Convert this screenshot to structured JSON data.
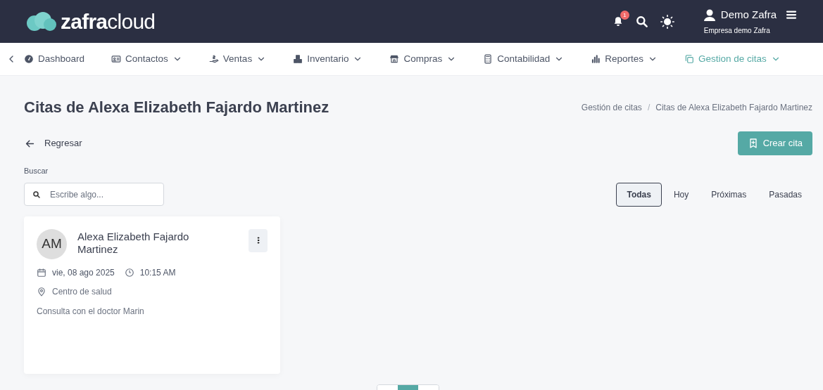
{
  "header": {
    "logo": {
      "bold": "zafra",
      "light": "cloud"
    },
    "notifications": "1",
    "user": {
      "name": "Demo Zafra",
      "company": "Empresa demo Zafra"
    }
  },
  "nav": [
    {
      "label": "Dashboard",
      "dropdown": false,
      "selected": false
    },
    {
      "label": "Contactos",
      "dropdown": true,
      "selected": false
    },
    {
      "label": "Ventas",
      "dropdown": true,
      "selected": false
    },
    {
      "label": "Inventario",
      "dropdown": true,
      "selected": false
    },
    {
      "label": "Compras",
      "dropdown": true,
      "selected": false
    },
    {
      "label": "Contabilidad",
      "dropdown": true,
      "selected": false
    },
    {
      "label": "Reportes",
      "dropdown": true,
      "selected": false
    },
    {
      "label": "Gestion de citas",
      "dropdown": true,
      "selected": true
    }
  ],
  "page": {
    "title": "Citas de Alexa Elizabeth Fajardo Martinez",
    "breadcrumb": [
      "Gestión de citas",
      "Citas de Alexa Elizabeth Fajardo Martinez"
    ],
    "separator": "/",
    "back": "Regresar",
    "create": "Crear cita"
  },
  "search": {
    "label": "Buscar",
    "placeholder": "Escribe algo..."
  },
  "filters": [
    {
      "label": "Todas",
      "selected": true
    },
    {
      "label": "Hoy",
      "selected": false
    },
    {
      "label": "Próximas",
      "selected": false
    },
    {
      "label": "Pasadas",
      "selected": false
    }
  ],
  "appointments": [
    {
      "initials": "AM",
      "name": "Alexa Elizabeth Fajardo Martinez",
      "date": "vie, 08 ago 2025",
      "time": "10:15 AM",
      "place": "Centro de salud",
      "note": "Consulta con el doctor Marin"
    }
  ],
  "pagination": [
    {
      "selected": false
    },
    {
      "selected": true
    },
    {
      "selected": false
    }
  ]
}
